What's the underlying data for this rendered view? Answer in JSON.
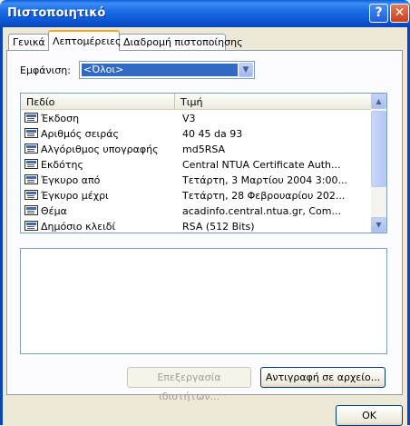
{
  "window": {
    "title": "Πιστοποιητικό",
    "help_glyph": "?",
    "close_glyph": "✕"
  },
  "tabs": [
    {
      "label": "Γενικά",
      "active": false
    },
    {
      "label": "Λεπτομέρειες",
      "active": true
    },
    {
      "label": "Διαδρομή πιστοποίησης",
      "active": false
    }
  ],
  "show": {
    "label": "Εμφάνιση:",
    "value": "<Όλοι>",
    "arrow": "▼"
  },
  "list": {
    "columns": {
      "field": "Πεδίο",
      "value": "Τιμή"
    },
    "rows": [
      {
        "field": "Έκδοση",
        "value": "V3"
      },
      {
        "field": "Αριθμός σειράς",
        "value": "40 45 da 93"
      },
      {
        "field": "Αλγόριθμος υπογραφής",
        "value": "md5RSA"
      },
      {
        "field": "Εκδότης",
        "value": "Central NTUA Certificate Auth..."
      },
      {
        "field": "Έγκυρο από",
        "value": "Τετάρτη, 3 Μαρτίου 2004 3:00..."
      },
      {
        "field": "Έγκυρο μέχρι",
        "value": "Τετάρτη, 28 Φεβρουαρίου 202..."
      },
      {
        "field": "Θέμα",
        "value": "acadinfo.central.ntua.gr, Com..."
      },
      {
        "field": "Δημόσιο κλειδί",
        "value": "RSA (512 Bits)"
      }
    ],
    "scroll_up": "▲",
    "scroll_down": "▼"
  },
  "buttons": {
    "edit_properties": "Επεξεργασία ιδιοτήτων...",
    "copy_to_file": "Αντιγραφή σε αρχείο...",
    "ok": "OK"
  }
}
